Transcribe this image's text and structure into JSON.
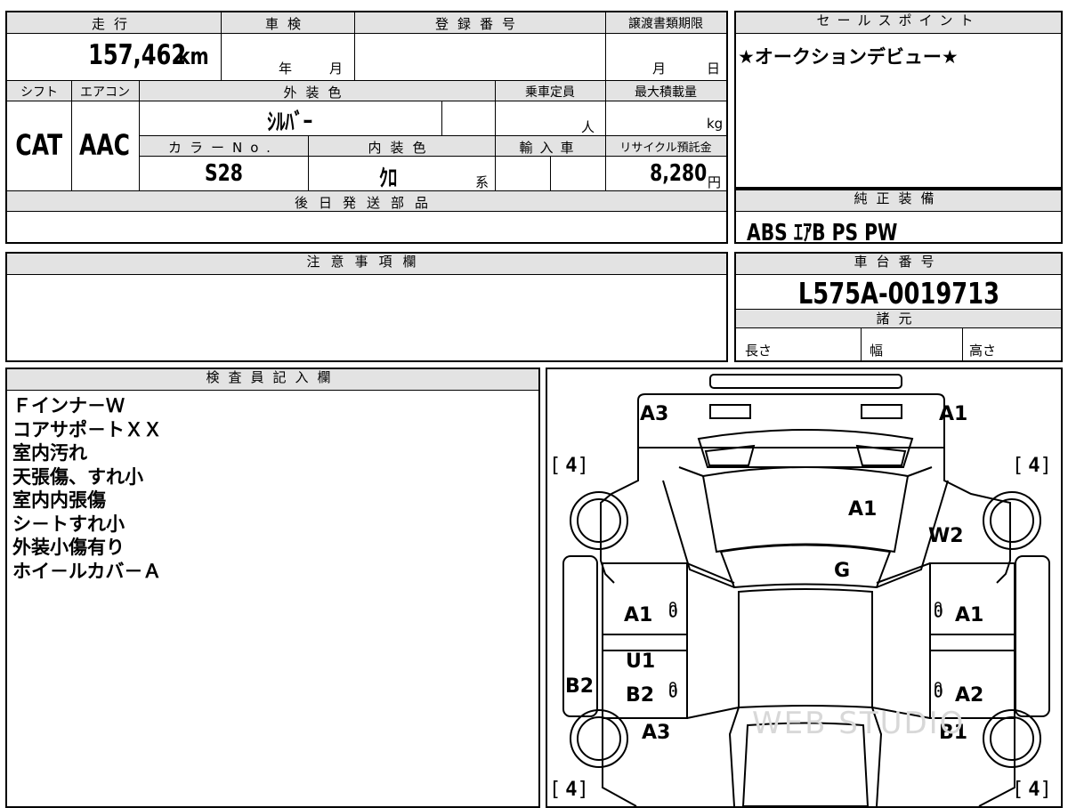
{
  "top_section": {
    "headers": {
      "mileage": "走行",
      "inspection": "車検",
      "registration_no": "登録番号",
      "transfer_doc_deadline": "譲渡書類期限",
      "shift": "シフト",
      "aircon": "エアコン",
      "exterior_color": "外装色",
      "capacity": "乗車定員",
      "max_load": "最大積載量",
      "color_no": "カラーNo.",
      "interior_color": "内装色",
      "import": "輸入車",
      "recycle": "リサイクル預託金",
      "later_parts": "後日発送部品"
    },
    "mileage_value": "157,462",
    "mileage_unit": "km",
    "inspection_year_unit": "年",
    "inspection_month_unit": "月",
    "deadline_month_unit": "月",
    "deadline_day_unit": "日",
    "shift_value": "CAT",
    "aircon_value": "AAC",
    "exterior_color_value": "ｼﾙﾊﾞｰ",
    "capacity_unit": "人",
    "max_load_unit": "kg",
    "color_no_value": "S28",
    "interior_color_value": "ｸﾛ",
    "interior_color_suffix": "系",
    "recycle_value": "8,280",
    "recycle_unit": "円"
  },
  "sales_point": {
    "header": "セールスポイント",
    "text": "★オークションデビュー★"
  },
  "factory_equipment": {
    "header": "純正装備",
    "value": "ABS ｴｱB PS PW"
  },
  "notes": {
    "header": "注意事項欄"
  },
  "chassis": {
    "header": "車台番号",
    "value": "L575A-0019713",
    "specs_header": "諸元",
    "length_label": "長さ",
    "width_label": "幅",
    "height_label": "高さ"
  },
  "inspector": {
    "header": "検査員記入欄",
    "lines": [
      "Ｆインナ－Ｗ",
      "コアサポ－トＸＸ",
      "室内汚れ",
      "天張傷、すれ小",
      "室内内張傷",
      "シ－トすれ小",
      "外装小傷有り",
      "ホイ－ルカバ－Ａ"
    ]
  },
  "diagram": {
    "labels": {
      "front_left_corner": "A3",
      "front_right_corner": "A1",
      "hood": "A1",
      "windshield": "G",
      "right_fender": "W2",
      "left_front_door": "A1",
      "right_front_door": "A1",
      "left_rear_door_a": "U1",
      "left_rear_door_b": "B2",
      "right_rear_door": "A2",
      "left_pillar": "B2",
      "left_rear_quarter": "A3",
      "right_rear_quarter": "B1"
    },
    "zero_marks": [
      "0",
      "0",
      "0",
      "0"
    ],
    "tire_tread": "4",
    "watermark": "WEB STUDIO"
  }
}
